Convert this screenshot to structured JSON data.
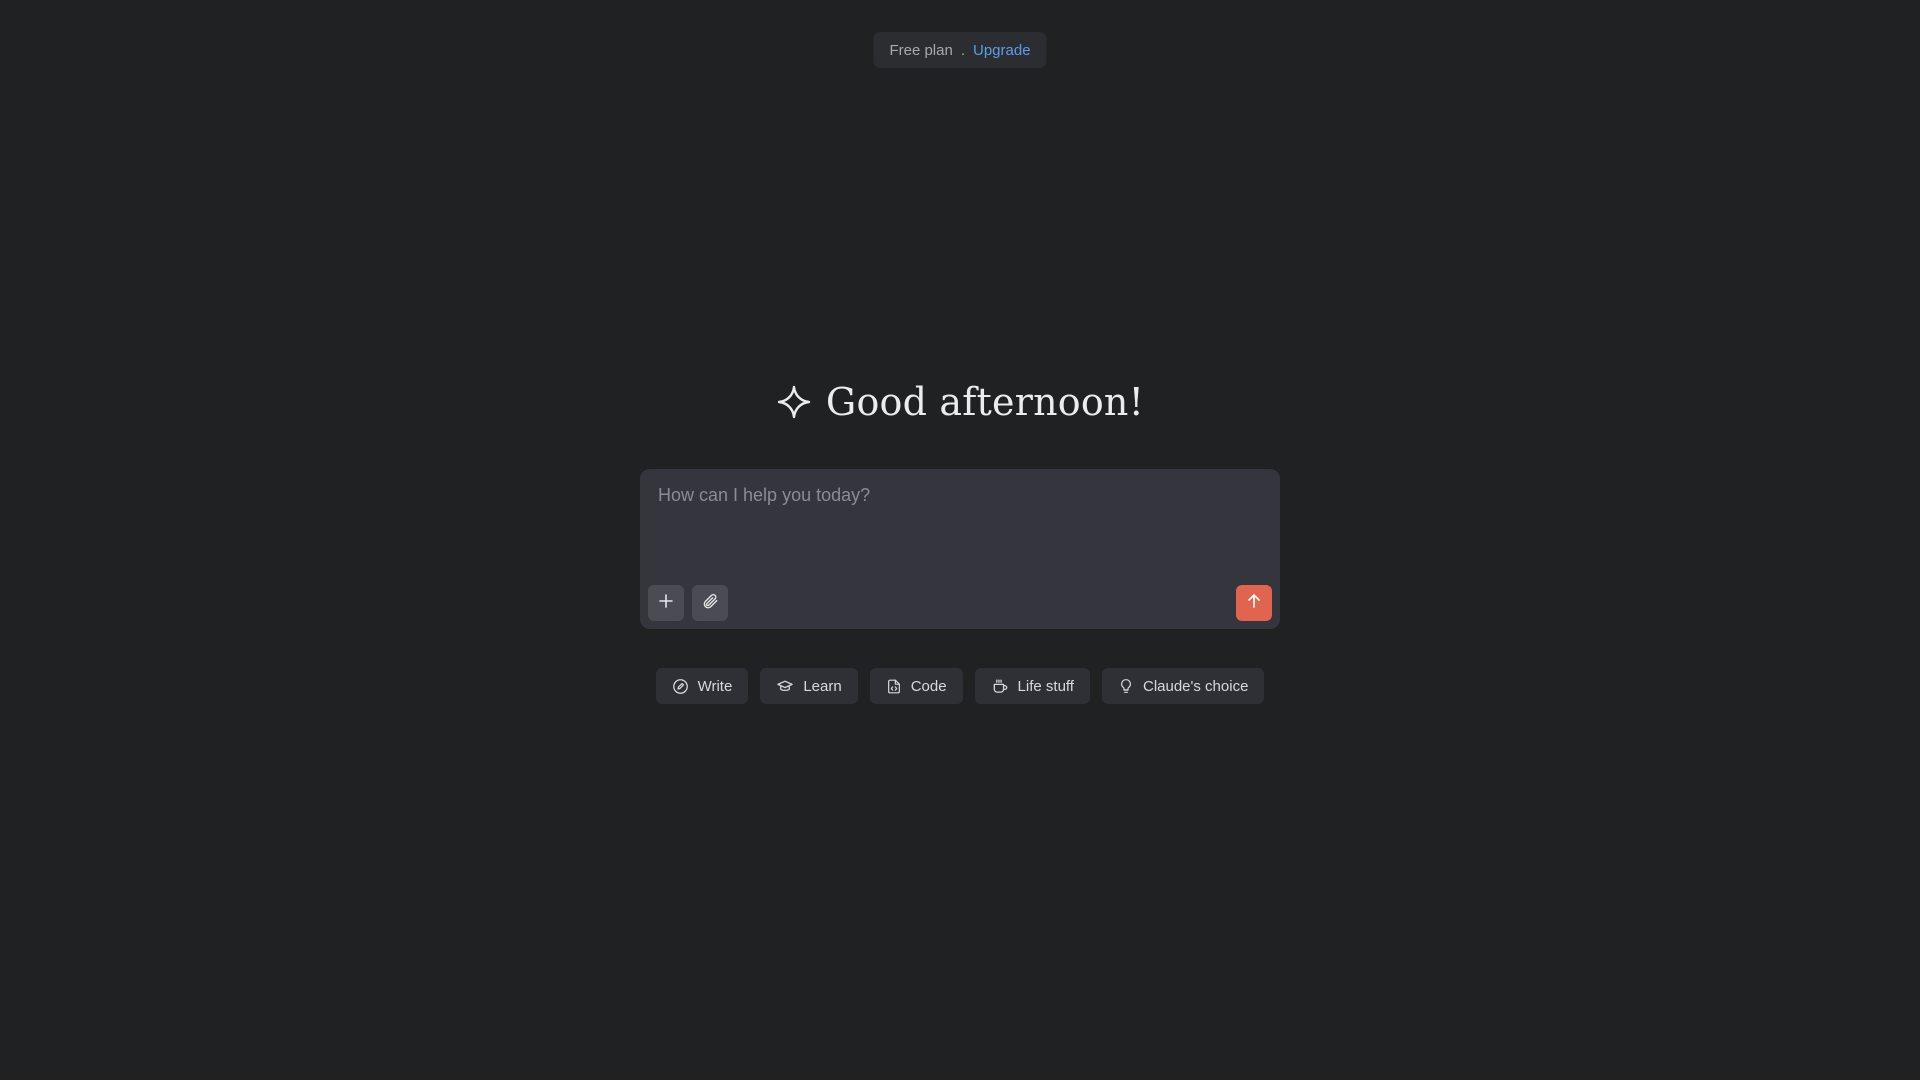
{
  "plan": {
    "label": "Free plan",
    "separator": ".",
    "upgrade_label": "Upgrade"
  },
  "greeting": {
    "icon": "sparkle-icon",
    "text": "Good afternoon!"
  },
  "composer": {
    "placeholder": "How can I help you today?",
    "value": "",
    "buttons": {
      "add": "plus-icon",
      "attach": "paperclip-icon",
      "send": "arrow-up-icon"
    },
    "send_color": "#e0644f"
  },
  "suggestions": [
    {
      "label": "Write",
      "icon": "pen-circle-icon"
    },
    {
      "label": "Learn",
      "icon": "graduation-cap-icon"
    },
    {
      "label": "Code",
      "icon": "code-file-icon"
    },
    {
      "label": "Life stuff",
      "icon": "coffee-cup-icon"
    },
    {
      "label": "Claude's choice",
      "icon": "lightbulb-icon"
    }
  ],
  "colors": {
    "background": "#202123",
    "accent": "#e0644f",
    "link": "#5b9ce8"
  }
}
